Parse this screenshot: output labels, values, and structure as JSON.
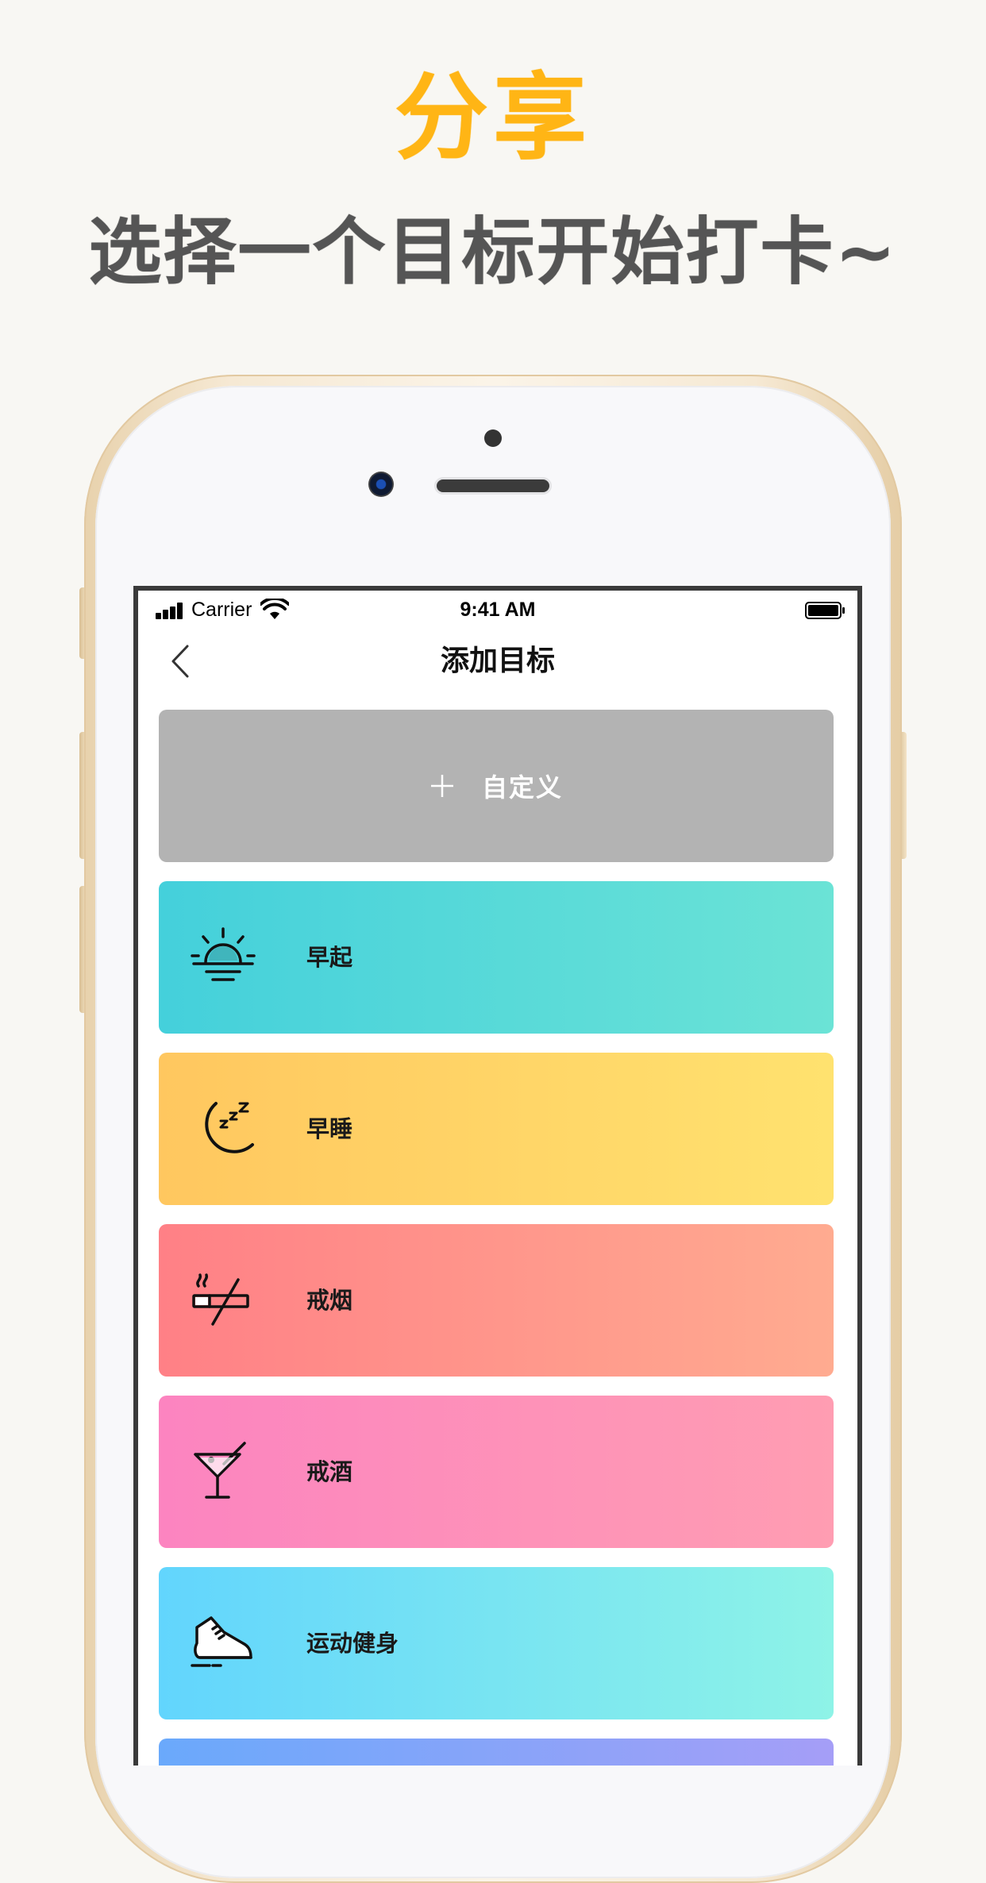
{
  "promo": {
    "title": "分享",
    "subtitle": "选择一个目标开始打卡~"
  },
  "status_bar": {
    "carrier": "Carrier",
    "time": "9:41 AM"
  },
  "nav": {
    "title": "添加目标"
  },
  "goals": {
    "custom": {
      "label": "自定义",
      "icon": "plus-icon"
    },
    "items": [
      {
        "label": "早起",
        "icon": "sunrise-icon",
        "colors": [
          "#44d0db",
          "#6be3d6"
        ]
      },
      {
        "label": "早睡",
        "icon": "moon-sleep-icon",
        "colors": [
          "#ffc75f",
          "#ffe26f"
        ]
      },
      {
        "label": "戒烟",
        "icon": "no-smoking-icon",
        "colors": [
          "#ff8086",
          "#ffab90"
        ]
      },
      {
        "label": "戒酒",
        "icon": "cocktail-icon",
        "colors": [
          "#fc84c0",
          "#ff9db2"
        ]
      },
      {
        "label": "运动健身",
        "icon": "sneaker-icon",
        "colors": [
          "#62d5fd",
          "#8ef3e7"
        ]
      },
      {
        "label": "",
        "icon": "",
        "colors": [
          "#6aa9fb",
          "#a59ef7"
        ]
      }
    ]
  },
  "colors": {
    "promo_title": "#ffb515",
    "promo_subtitle": "#555555",
    "custom_card": "#b3b3b3"
  }
}
